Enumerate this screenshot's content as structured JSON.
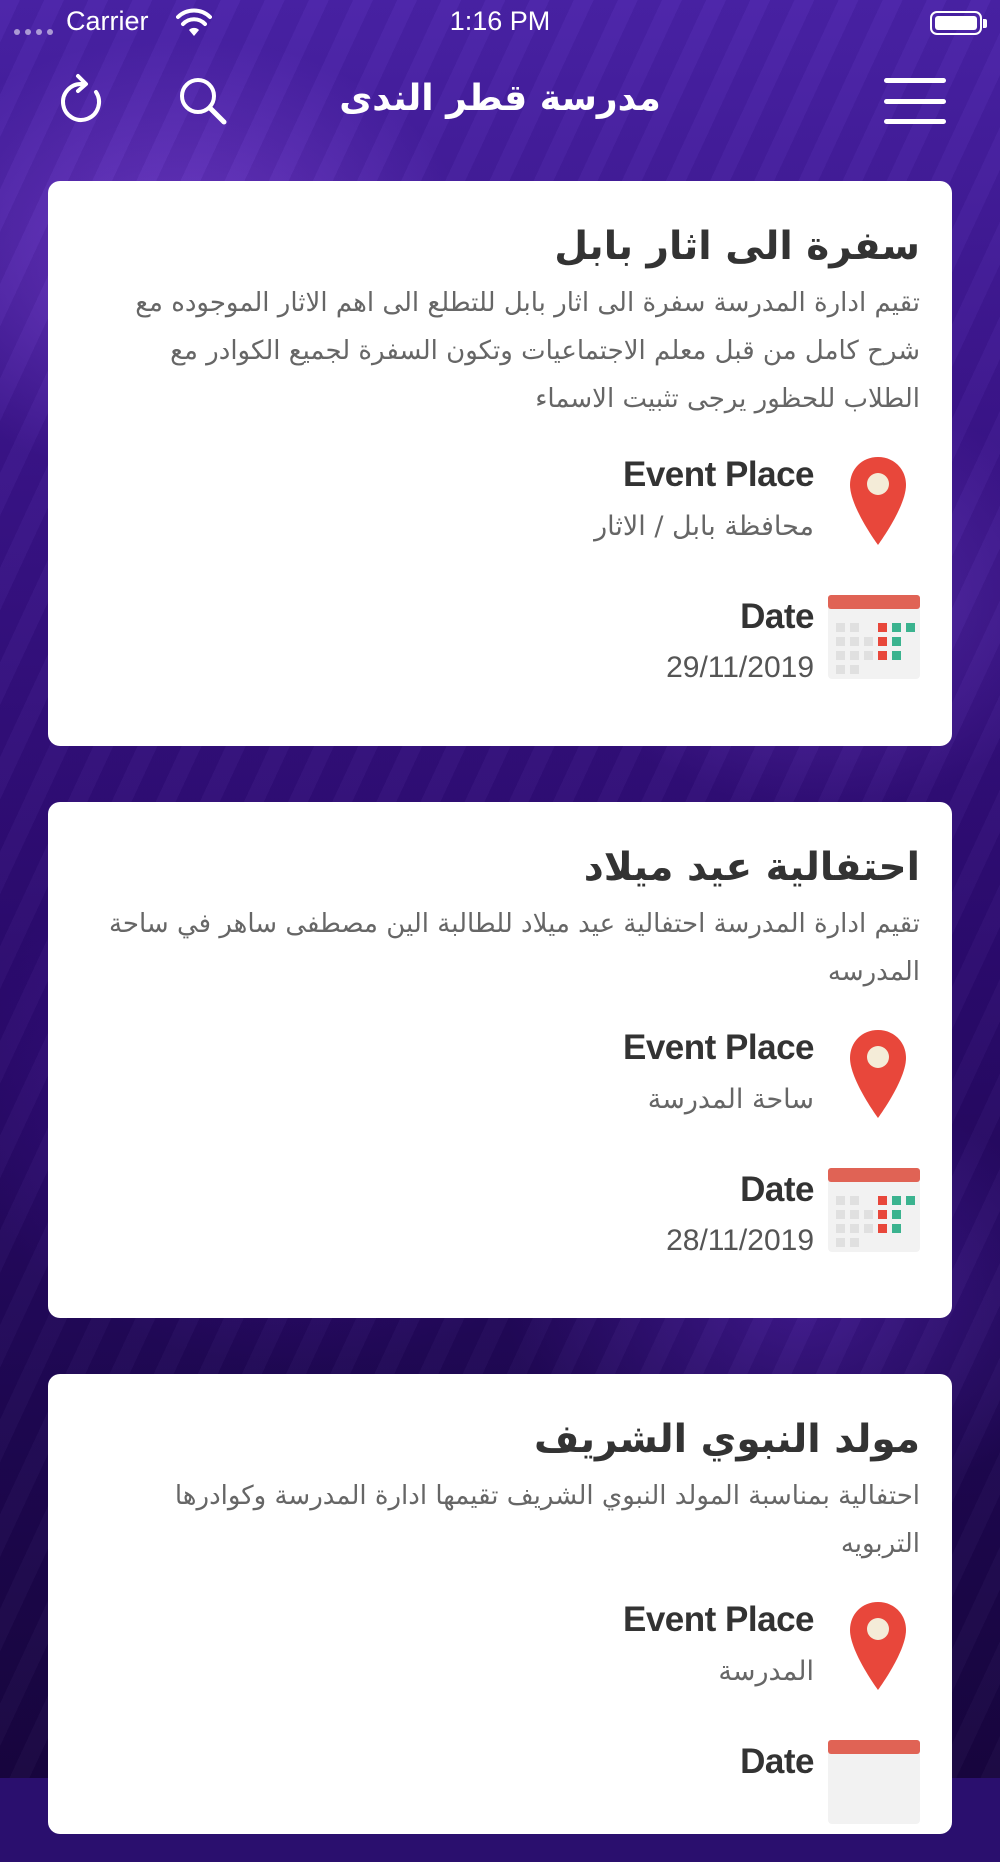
{
  "status_bar": {
    "carrier": "Carrier",
    "time": "1:16 PM"
  },
  "nav": {
    "title": "مدرسة قطر الندى",
    "icons": [
      "refresh-icon",
      "search-icon",
      "menu-icon"
    ]
  },
  "labels": {
    "place": "Event Place",
    "date": "Date"
  },
  "colors": {
    "background": "#2a0f6e",
    "pin": "#e8473b",
    "calendar_header": "#e06355",
    "calendar_green": "#3bb38f"
  },
  "events": [
    {
      "title": "سفرة الى اثار بابل",
      "description": "تقيم ادارة المدرسة سفرة الى اثار بابل للتطلع الى اهم الاثار الموجوده مع شرح كامل من قبل معلم الاجتماعيات وتكون السفرة لجميع الكوادر مع الطلاب للحظور يرجى تثبيت الاسماء",
      "place": "محافظة بابل / الاثار",
      "date": "29/11/2019"
    },
    {
      "title": "احتفالية عيد ميلاد",
      "description": "تقيم ادارة المدرسة احتفالية عيد ميلاد للطالبة الين مصطفى ساهر في ساحة المدرسه",
      "place": "ساحة المدرسة",
      "date": "28/11/2019"
    },
    {
      "title": "مولد النبوي الشريف",
      "description": "احتفالية بمناسبة المولد النبوي الشريف تقيمها ادارة المدرسة وكوادرها التربويه",
      "place": "المدرسة",
      "date": ""
    }
  ]
}
